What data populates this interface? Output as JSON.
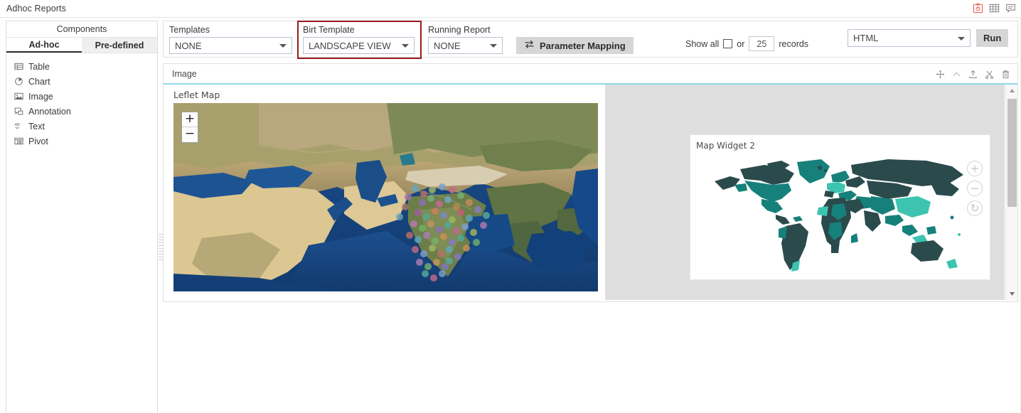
{
  "titlebar": {
    "app_title": "Adhoc Reports",
    "icons": [
      {
        "name": "report-clipboard-icon",
        "color": "#e8736a"
      },
      {
        "name": "table-grid-icon",
        "color": "#8a8a8a"
      },
      {
        "name": "comment-note-icon",
        "color": "#8a8a8a"
      }
    ]
  },
  "sidebar": {
    "header": "Components",
    "tabs": [
      {
        "label": "Ad-hoc",
        "active": true
      },
      {
        "label": "Pre-defined",
        "active": false
      }
    ],
    "items": [
      {
        "label": "Table",
        "icon": "table-icon"
      },
      {
        "label": "Chart",
        "icon": "chart-pie-icon"
      },
      {
        "label": "Image",
        "icon": "image-icon"
      },
      {
        "label": "Annotation",
        "icon": "annotation-icon"
      },
      {
        "label": "Text",
        "icon": "text-abc-icon"
      },
      {
        "label": "Pivot",
        "icon": "pivot-icon"
      }
    ]
  },
  "toolbar": {
    "templates": {
      "label": "Templates",
      "value": "NONE"
    },
    "birt_template": {
      "label": "Birt Template",
      "value": "LANDSCAPE VIEW",
      "highlight_color": "#9b1b1b"
    },
    "running_report": {
      "label": "Running Report",
      "value": "NONE"
    },
    "parameter_mapping_label": "Parameter Mapping",
    "show_all_label": "Show all",
    "or_label": "or",
    "records_value": "25",
    "records_label": "records",
    "format": {
      "value": "HTML"
    },
    "run_label": "Run"
  },
  "panel": {
    "title": "Image",
    "tools": [
      {
        "name": "move-icon"
      },
      {
        "name": "chevron-up-icon"
      },
      {
        "name": "export-upload-icon"
      },
      {
        "name": "cut-scissors-icon"
      },
      {
        "name": "delete-trash-icon"
      }
    ],
    "leaflet": {
      "label": "Leflet Map",
      "zoom_in": "+",
      "zoom_out": "−"
    },
    "map_widget": {
      "title": "Map Widget 2",
      "zoom_in": "+",
      "zoom_out": "−",
      "reset": "↻"
    }
  },
  "colors": {
    "accent_cyan": "#8fd8e8",
    "teal_dark": "#2b4a4c",
    "teal_mid": "#16807a",
    "teal_light": "#3dc4b0",
    "panel_grey": "#dedede"
  }
}
